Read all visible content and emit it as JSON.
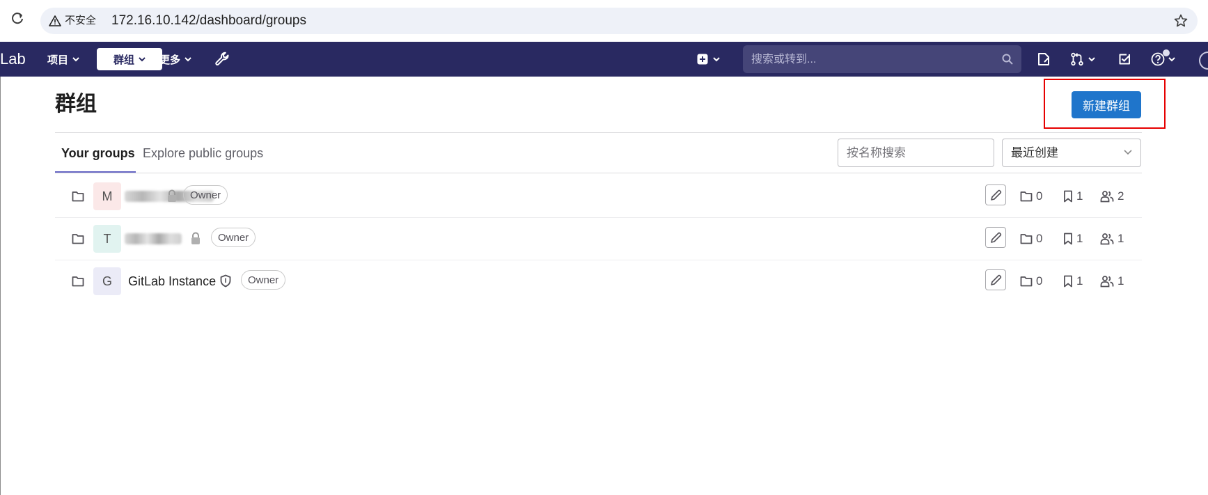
{
  "browser": {
    "security_label": "不安全",
    "url": "172.16.10.142/dashboard/groups"
  },
  "navbar": {
    "brand": "Lab",
    "items": [
      {
        "label": "项目"
      },
      {
        "label": "群组"
      },
      {
        "label": "更多"
      }
    ],
    "search_placeholder": "搜索或转到..."
  },
  "page": {
    "title": "群组",
    "new_group_label": "新建群组"
  },
  "tabs": [
    {
      "label": "Your groups"
    },
    {
      "label": "Explore public groups"
    }
  ],
  "filter": {
    "search_placeholder": "按名称搜索",
    "sort_selected": "最近创建"
  },
  "groups": [
    {
      "avatar_letter": "M",
      "avatar_color": "#fbe8e8",
      "name": "",
      "visibility": "private",
      "role": "Owner",
      "subgroups": "0",
      "projects": "1",
      "members": "2"
    },
    {
      "avatar_letter": "T",
      "avatar_color": "#e1f3f0",
      "name": "",
      "visibility": "private",
      "role": "Owner",
      "subgroups": "0",
      "projects": "1",
      "members": "1"
    },
    {
      "avatar_letter": "G",
      "avatar_color": "#ebebf7",
      "name": "GitLab Instance",
      "visibility": "internal",
      "role": "Owner",
      "subgroups": "0",
      "projects": "1",
      "members": "1"
    }
  ],
  "colors": {
    "navbar": "#292961",
    "primary_button": "#1f75cb",
    "annotation_box": "#e60000",
    "tab_underline": "#6666c4"
  }
}
